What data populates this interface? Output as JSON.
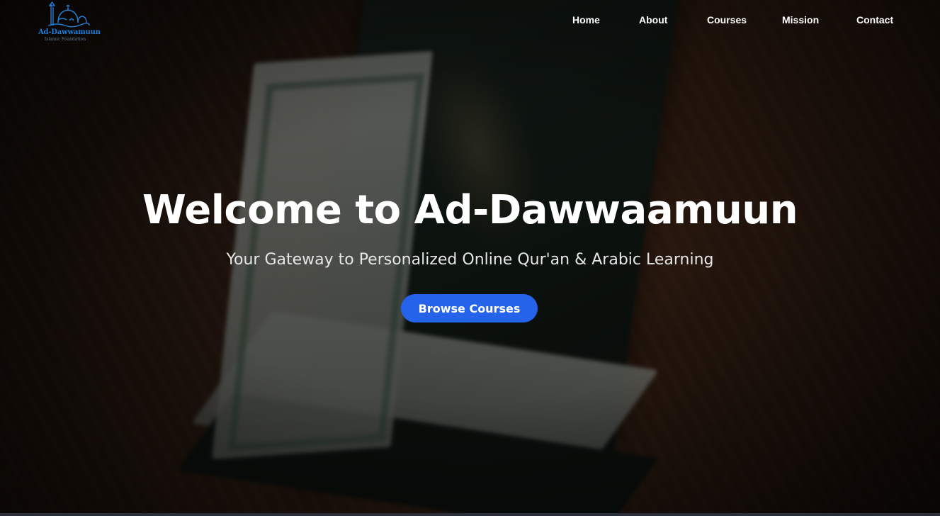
{
  "brand": {
    "name": "Ad-Dawwamuun",
    "tagline": "Islamic Foundation",
    "accent_color": "#1f7fd6",
    "logo_icon": "mosque-icon"
  },
  "nav": {
    "items": [
      {
        "label": "Home"
      },
      {
        "label": "About"
      },
      {
        "label": "Courses"
      },
      {
        "label": "Mission"
      },
      {
        "label": "Contact"
      }
    ]
  },
  "hero": {
    "title": "Welcome to Ad-Dawwaamuun",
    "subtitle": "Your Gateway to Personalized Online Qur'an & Arabic Learning",
    "cta_label": "Browse Courses",
    "cta_color": "#2563eb",
    "background_image": "blurred-open-quran-on-wooden-table"
  }
}
